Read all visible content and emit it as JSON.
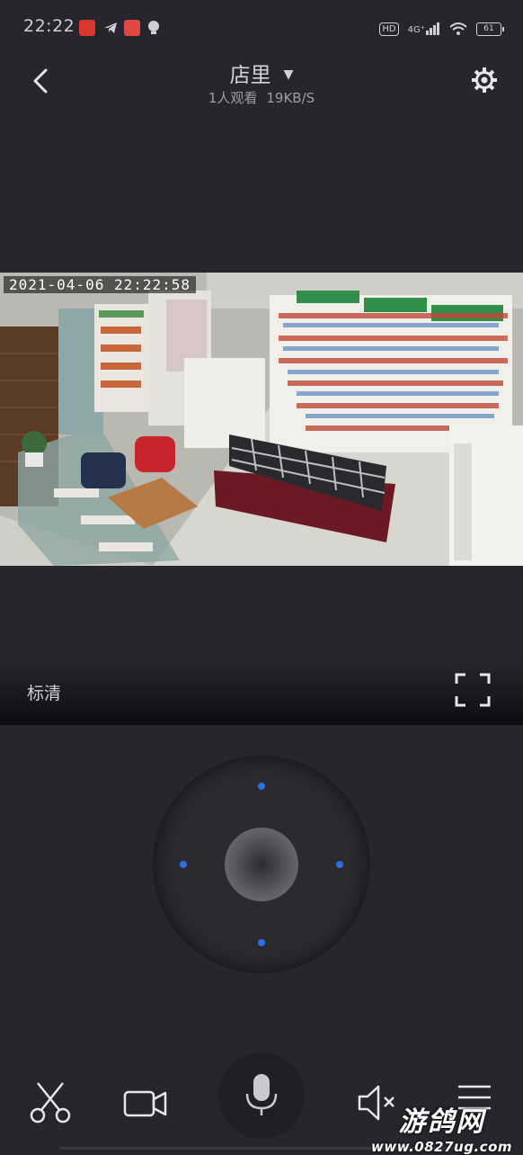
{
  "status_bar": {
    "time": "22:22",
    "hd_badge": "HD",
    "network": "4G⁺",
    "battery": "61"
  },
  "header": {
    "title": "店里",
    "viewers": "1人观看",
    "bitrate": "19KB/S"
  },
  "video": {
    "timestamp": "2021-04-06  22:22:58"
  },
  "quality": {
    "label": "标清"
  },
  "watermark": {
    "brand": "游鸽网",
    "url": "www.0827ug.com"
  },
  "colors": {
    "background": "#26272e",
    "accent_dot": "#2f6ee0"
  }
}
